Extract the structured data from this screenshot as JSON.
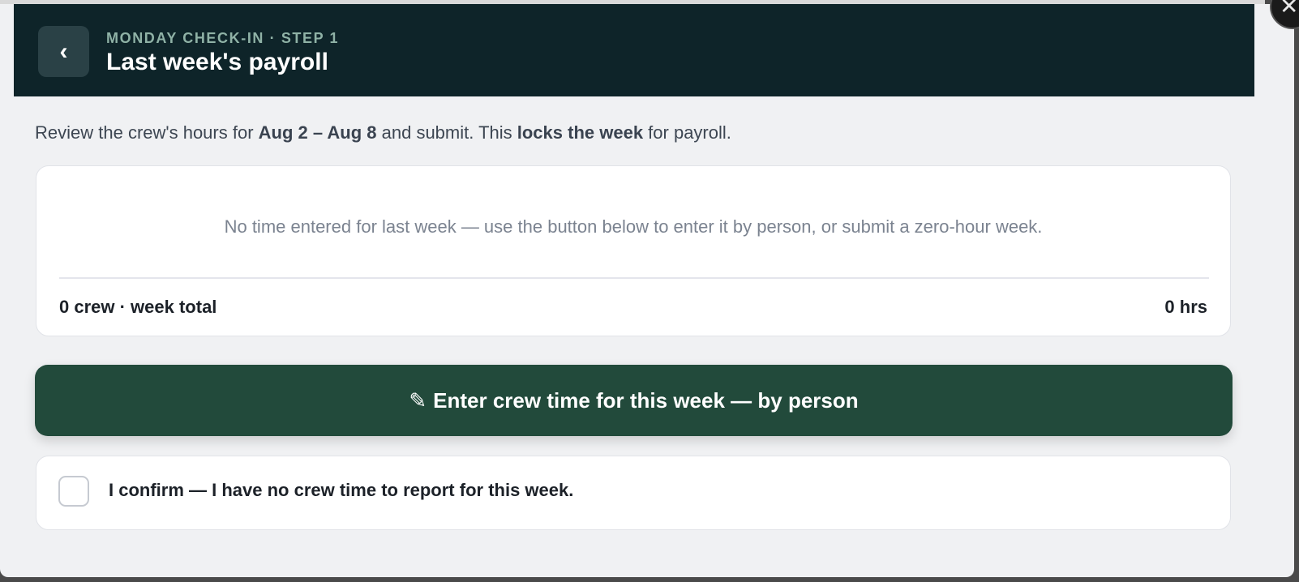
{
  "header": {
    "back_icon": "‹",
    "eyebrow": "MONDAY CHECK-IN · STEP 1",
    "title": "Last week's payroll"
  },
  "intro": {
    "part1": "Review the crew's hours for ",
    "date_range": "Aug 2 – Aug 8",
    "part2": " and submit. This ",
    "emphasis": "locks the week",
    "part3": " for payroll."
  },
  "summary": {
    "empty_message": "No time entered for last week — use the button below to enter it by person, or submit a zero-hour week.",
    "total_label": "0 crew · week total",
    "total_value": "0 hrs"
  },
  "enter_button": {
    "icon": "✎",
    "label": "Enter crew time for this week — by person"
  },
  "confirm": {
    "label": "I confirm — I have no crew time to report for this week.",
    "checked": false
  },
  "close_icon": "✕",
  "colors": {
    "header_bg": "#0e2429",
    "primary_button": "#224a3b",
    "eyebrow": "#8fb2a6"
  }
}
